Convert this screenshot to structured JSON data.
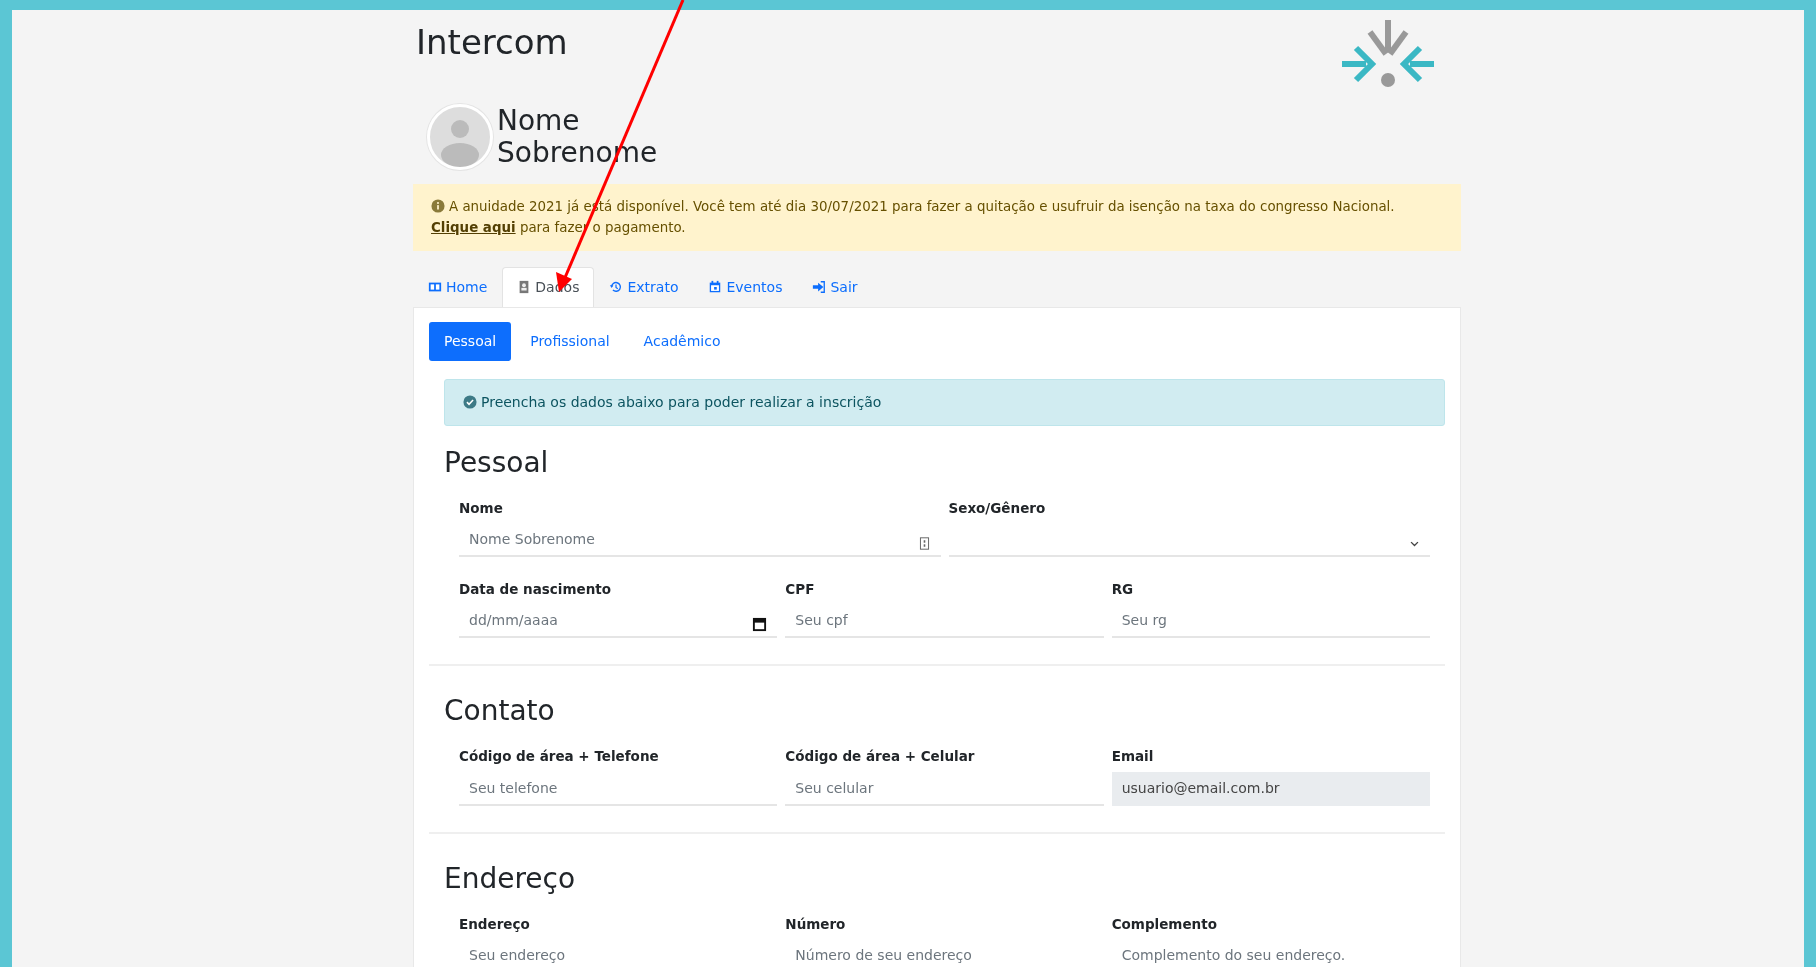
{
  "header": {
    "title": "Intercom",
    "user_name": "Nome Sobrenome"
  },
  "notice": {
    "text": "A anuidade 2021 já está disponível. Você tem até dia 30/07/2021 para fazer a quitação e usufruir da isenção na taxa do congresso Nacional.",
    "link": "Clique aqui",
    "after": "para fazer o pagamento."
  },
  "tabs": [
    {
      "label": "Home",
      "kind": "home",
      "selected": false
    },
    {
      "label": "Dados",
      "kind": "person",
      "selected": true
    },
    {
      "label": "Extrato",
      "kind": "history",
      "selected": false
    },
    {
      "label": "Eventos",
      "kind": "calendar",
      "selected": false
    },
    {
      "label": "Sair",
      "kind": "exit",
      "selected": false
    }
  ],
  "subtabs": [
    {
      "label": "Pessoal",
      "selected": true
    },
    {
      "label": "Profissional",
      "selected": false
    },
    {
      "label": "Acadêmico",
      "selected": false
    }
  ],
  "info": {
    "text": "Preencha os dados abaixo para poder realizar a inscrição"
  },
  "sections": [
    {
      "title": "Pessoal",
      "rows": [
        [
          {
            "label": "Nome",
            "kind": "contact",
            "placeholder": "Nome Sobrenome",
            "readonly": false
          },
          {
            "label": "Sexo/Gênero",
            "kind": "select",
            "readonly": false
          }
        ],
        [
          {
            "label": "Data de nascimento",
            "kind": "date",
            "placeholder": "dd/mm/aaaa",
            "readonly": false
          },
          {
            "label": "CPF",
            "kind": "text",
            "placeholder": "Seu cpf",
            "readonly": false
          },
          {
            "label": "RG",
            "kind": "text",
            "placeholder": "Seu rg",
            "readonly": false
          }
        ]
      ]
    },
    {
      "title": "Contato",
      "rows": [
        [
          {
            "label": "Código de área + Telefone",
            "kind": "text",
            "placeholder": "Seu telefone",
            "readonly": false
          },
          {
            "label": "Código de área + Celular",
            "kind": "text",
            "placeholder": "Seu celular",
            "readonly": false
          },
          {
            "label": "Email",
            "kind": "text",
            "value": "usuario@email.com.br",
            "readonly": true
          }
        ]
      ]
    },
    {
      "title": "Endereço",
      "rows": [
        [
          {
            "label": "Endereço",
            "kind": "text",
            "placeholder": "Seu endereço",
            "readonly": false
          },
          {
            "label": "Número",
            "kind": "text",
            "placeholder": "Número de seu endereço",
            "readonly": false
          },
          {
            "label": "Complemento",
            "kind": "text",
            "placeholder": "Complemento do seu endereço.",
            "readonly": false
          }
        ]
      ]
    }
  ]
}
